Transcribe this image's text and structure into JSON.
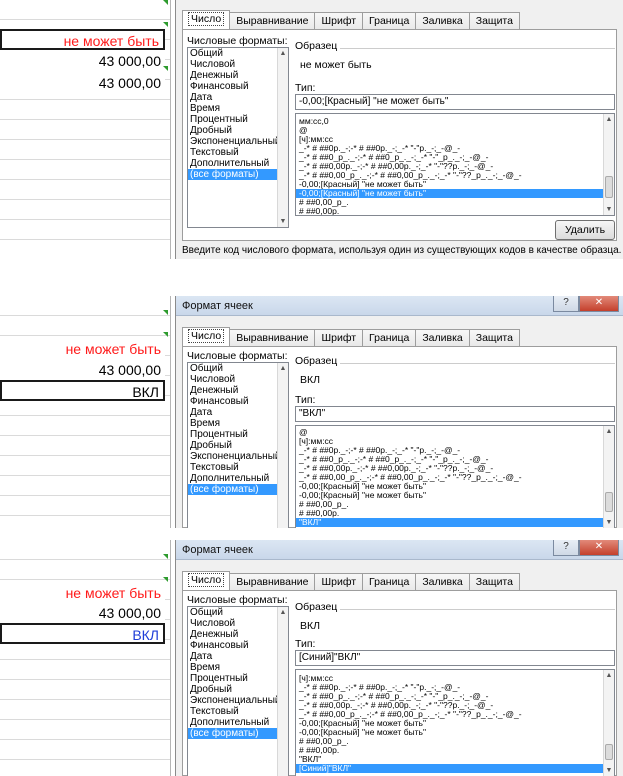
{
  "panels": [
    {
      "id": "p1",
      "dialog_title": "",
      "cells": [
        {
          "text": "не может быть",
          "color": "red",
          "selected": true
        },
        {
          "text": "43 000,00",
          "color": "black",
          "selected": false
        },
        {
          "text": "43 000,00",
          "color": "black",
          "selected": false
        }
      ],
      "sample": "не может быть",
      "type_value": "-0,00;[Красный] \"не может быть\"",
      "formats": [
        "мм:сс,0",
        "@",
        "[ч]:мм:сс",
        "_-* # ##0р._-;-* # ##0р._-;_-* \"-\"р._-;_-@_-",
        "_-* # ##0_р_._-;-* # ##0_р_._-;_-* \"-\"_р_._-;_-@_-",
        "_-* # ##0,00р._-;-* # ##0,00р._-;_-* \"-\"??р._-;_-@_-",
        "_-* # ##0,00_р_._-;-* # ##0,00_р_._-;_-* \"-\"??_р_._-;_-@_-",
        "-0,00;[Красный] \"не может быть\"",
        "-0,00;[Красный] \"не может быть\"",
        "# ##0,00_р_.",
        "# ##0,00р."
      ],
      "selected_format": 8,
      "show_delete": true,
      "show_hint": true
    },
    {
      "id": "p2",
      "dialog_title": "Формат ячеек",
      "cells": [
        {
          "text": "не может быть",
          "color": "red",
          "selected": false
        },
        {
          "text": "43 000,00",
          "color": "black",
          "selected": false
        },
        {
          "text": "ВКЛ",
          "color": "black",
          "selected": true
        }
      ],
      "sample": "ВКЛ",
      "type_value": "\"ВКЛ\"",
      "formats": [
        "@",
        "[ч]:мм:сс",
        "_-* # ##0р._-;-* # ##0р._-;_-* \"-\"р._-;_-@_-",
        "_-* # ##0_р_._-;-* # ##0_р_._-;_-* \"-\"_р_._-;_-@_-",
        "_-* # ##0,00р._-;-* # ##0,00р._-;_-* \"-\"??р._-;_-@_-",
        "_-* # ##0,00_р_._-;-* # ##0,00_р_._-;_-* \"-\"??_р_._-;_-@_-",
        "-0,00;[Красный] \"не может быть\"",
        "-0,00;[Красный] \"не может быть\"",
        "# ##0,00_р_.",
        "# ##0,00р.",
        "\"ВКЛ\""
      ],
      "selected_format": 10,
      "show_delete": false,
      "show_hint": false
    },
    {
      "id": "p3",
      "dialog_title": "Формат ячеек",
      "cells": [
        {
          "text": "не может быть",
          "color": "red",
          "selected": false
        },
        {
          "text": "43 000,00",
          "color": "black",
          "selected": false
        },
        {
          "text": "ВКЛ",
          "color": "blue",
          "selected": true
        }
      ],
      "sample": "ВКЛ",
      "type_value": "[Синий]\"ВКЛ\"",
      "formats": [
        "[ч]:мм:сс",
        "_-* # ##0р._-;-* # ##0р._-;_-* \"-\"р._-;_-@_-",
        "_-* # ##0_р_._-;-* # ##0_р_._-;_-* \"-\"_р_._-;_-@_-",
        "_-* # ##0,00р._-;-* # ##0,00р._-;_-* \"-\"??р._-;_-@_-",
        "_-* # ##0,00_р_._-;-* # ##0,00_р_._-;_-* \"-\"??_р_._-;_-@_-",
        "-0,00;[Красный] \"не может быть\"",
        "-0,00;[Красный] \"не может быть\"",
        "# ##0,00_р_.",
        "# ##0,00р.",
        "\"ВКЛ\"",
        "[Синий]\"ВКЛ\""
      ],
      "selected_format": 10,
      "show_delete": false,
      "show_hint": false
    }
  ],
  "tabs": [
    "Число",
    "Выравнивание",
    "Шрифт",
    "Граница",
    "Заливка",
    "Защита"
  ],
  "labels": {
    "number_formats": "Числовые форматы:",
    "sample": "Образец",
    "type": "Тип:",
    "delete": "Удалить",
    "hint": "Введите код числового формата, используя один из существующих кодов в качестве образца."
  },
  "categories": [
    "Общий",
    "Числовой",
    "Денежный",
    "Финансовый",
    "Дата",
    "Время",
    "Процентный",
    "Дробный",
    "Экспоненциальный",
    "Текстовый",
    "Дополнительный",
    "(все форматы)"
  ],
  "selected_category": 11,
  "colors": {
    "red": "#ff1a1a",
    "blue": "#1f3ed8",
    "selection": "#3399ff"
  }
}
